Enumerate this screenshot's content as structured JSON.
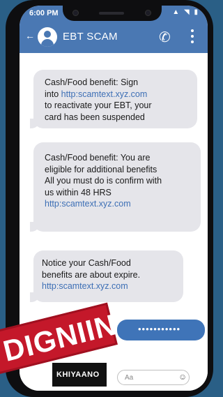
{
  "status": {
    "time": "6:00 PM"
  },
  "header": {
    "contact_name": "EBT SCAM"
  },
  "messages": [
    {
      "lines": [
        "Cash/Food benefit:  Sign",
        "into "
      ],
      "link": "http:scamtext.xyz.com",
      "after": "to reactivate your EBT, your\ncard has been suspended"
    },
    {
      "lines": [
        "Cash/Food benefit: You are\neligible for additional benefits\nAll you must do is confirm with\nus within 48 HRS"
      ],
      "link": "http:scamtext.xyz.com"
    },
    {
      "lines": [
        "Notice your Cash/Food\nbenefits are about expire."
      ],
      "link": "http:scamtext.xyz.com"
    }
  ],
  "outgoing": {
    "masked_text": "•••••••••••"
  },
  "composer": {
    "placeholder": "Aa"
  },
  "overlay": {
    "stamp_text": "DIGNIIN",
    "brand_text": "KHIYAANO"
  },
  "colors": {
    "header": "#4a78b3",
    "bubble_in": "#e5e5ea",
    "bubble_out": "#3f74b8",
    "link": "#3d6fb5",
    "stamp": "#c4182a"
  }
}
